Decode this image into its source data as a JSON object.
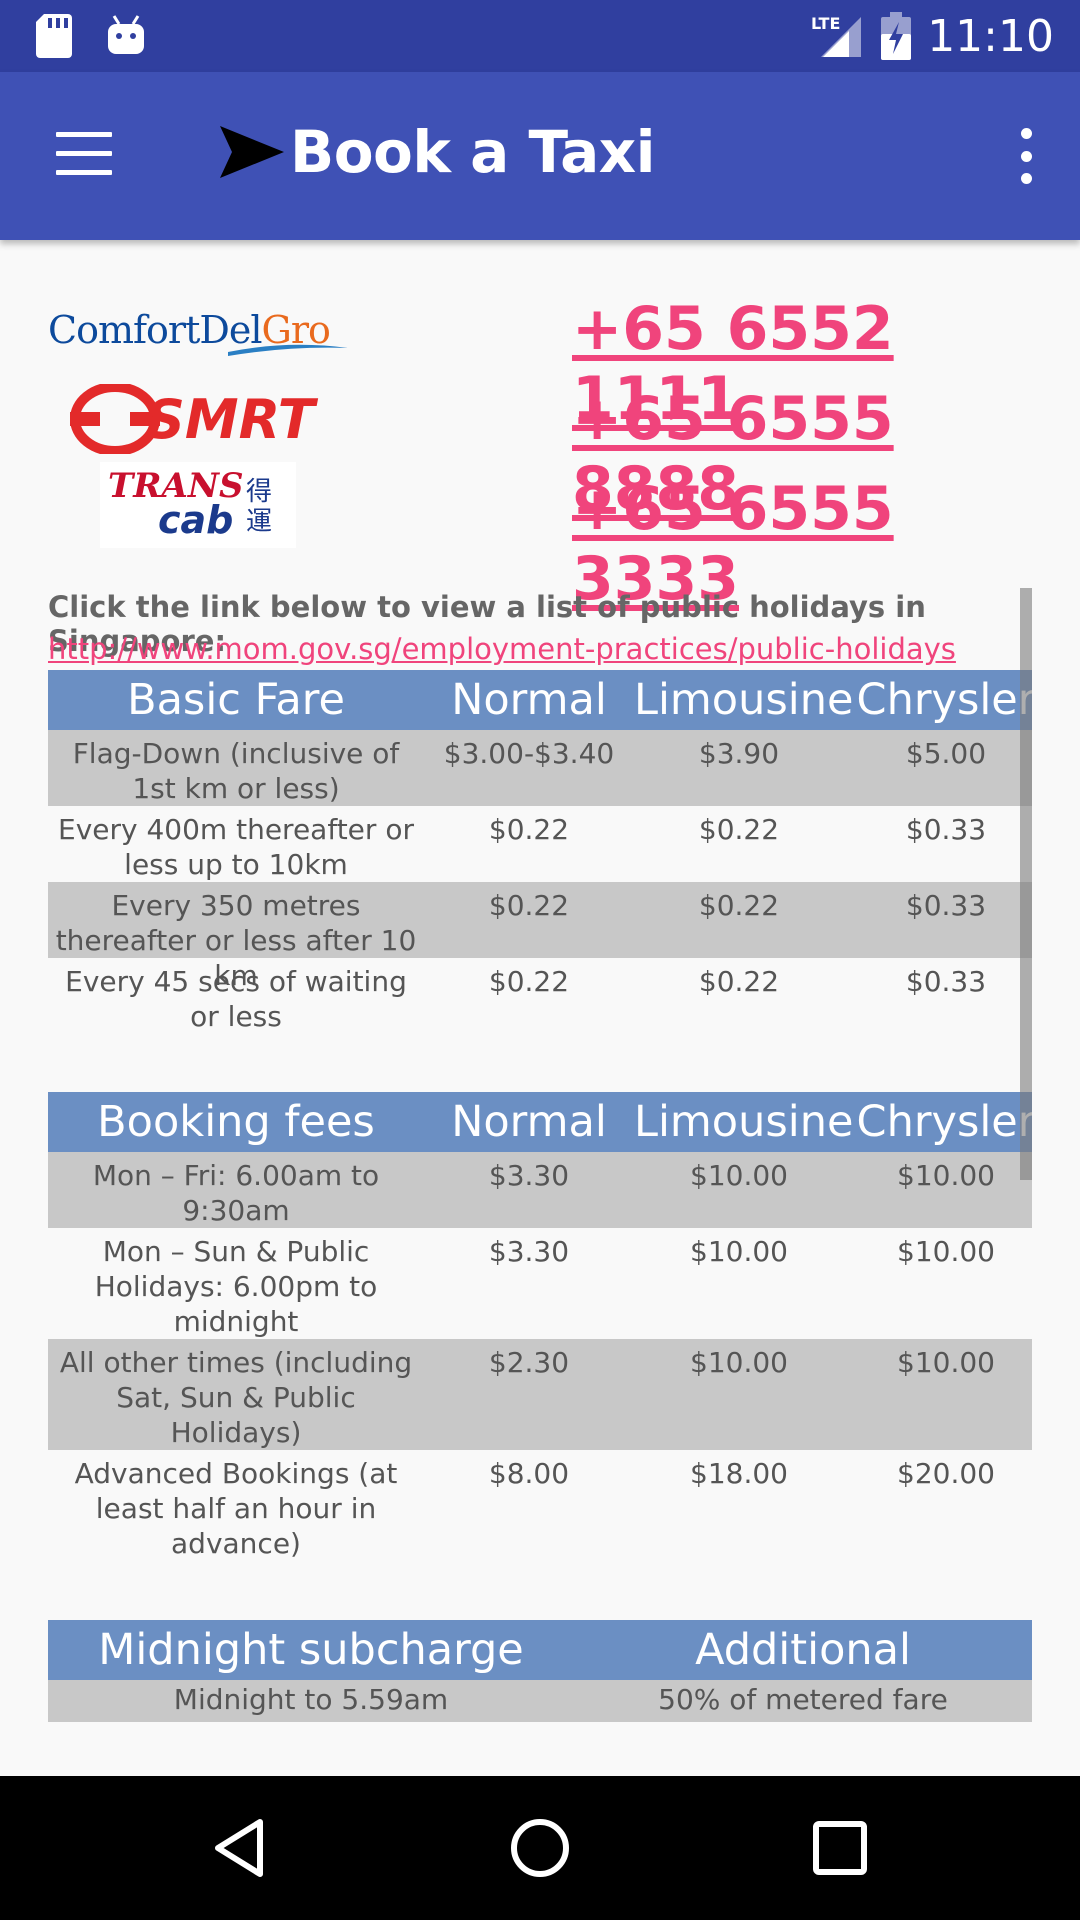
{
  "status_bar": {
    "network": "LTE",
    "time": "11:10"
  },
  "app_bar": {
    "title": "Book a Taxi"
  },
  "operators": [
    {
      "name": "ComfortDelGro",
      "logo_part1": "ComfortDel",
      "logo_part2": "Gro",
      "phone": "+65 6552 1111"
    },
    {
      "name": "SMRT",
      "logo_text": "SMRT",
      "phone": "+65 6555 8888"
    },
    {
      "name": "Trans cab",
      "logo_text1": "TRANS",
      "logo_text2": "cab",
      "logo_chinese": "得運",
      "phone": "+65 6555 3333"
    }
  ],
  "holiday": {
    "note": "Click the link below to view a list of public holidays in Singapore:",
    "link": "http://www.mom.gov.sg/employment-practices/public-holidays"
  },
  "basic_fare": {
    "headers": [
      "Basic Fare",
      "Normal",
      "Limousine",
      "Chrysler"
    ],
    "rows": [
      [
        "Flag-Down (inclusive of 1st km or less)",
        "$3.00-$3.40",
        "$3.90",
        "$5.00"
      ],
      [
        "Every 400m thereafter or less up to 10km",
        "$0.22",
        "$0.22",
        "$0.33"
      ],
      [
        "Every 350 metres thereafter or less after 10 km",
        "$0.22",
        "$0.22",
        "$0.33"
      ],
      [
        "Every 45 secs of waiting or less",
        "$0.22",
        "$0.22",
        "$0.33"
      ]
    ]
  },
  "booking_fees": {
    "headers": [
      "Booking fees",
      "Normal",
      "Limousine",
      "Chrysler"
    ],
    "rows": [
      [
        "Mon – Fri: 6.00am to 9:30am",
        "$3.30",
        "$10.00",
        "$10.00"
      ],
      [
        "Mon – Sun & Public Holidays: 6.00pm to midnight",
        "$3.30",
        "$10.00",
        "$10.00"
      ],
      [
        "All other times (including Sat, Sun & Public Holidays)",
        "$2.30",
        "$10.00",
        "$10.00"
      ],
      [
        "Advanced Bookings (at least half an hour in advance)",
        "$8.00",
        "$18.00",
        "$20.00"
      ]
    ]
  },
  "midnight": {
    "headers": [
      "Midnight subcharge",
      "Additional"
    ],
    "rows": [
      [
        "Midnight to 5.59am",
        "50% of metered fare"
      ]
    ]
  },
  "colors": {
    "status_bar": "#303f9f",
    "app_bar": "#3f51b5",
    "accent": "#f0447c",
    "table_header": "#6b8fc3",
    "row_alt": "#c8c8c8"
  }
}
